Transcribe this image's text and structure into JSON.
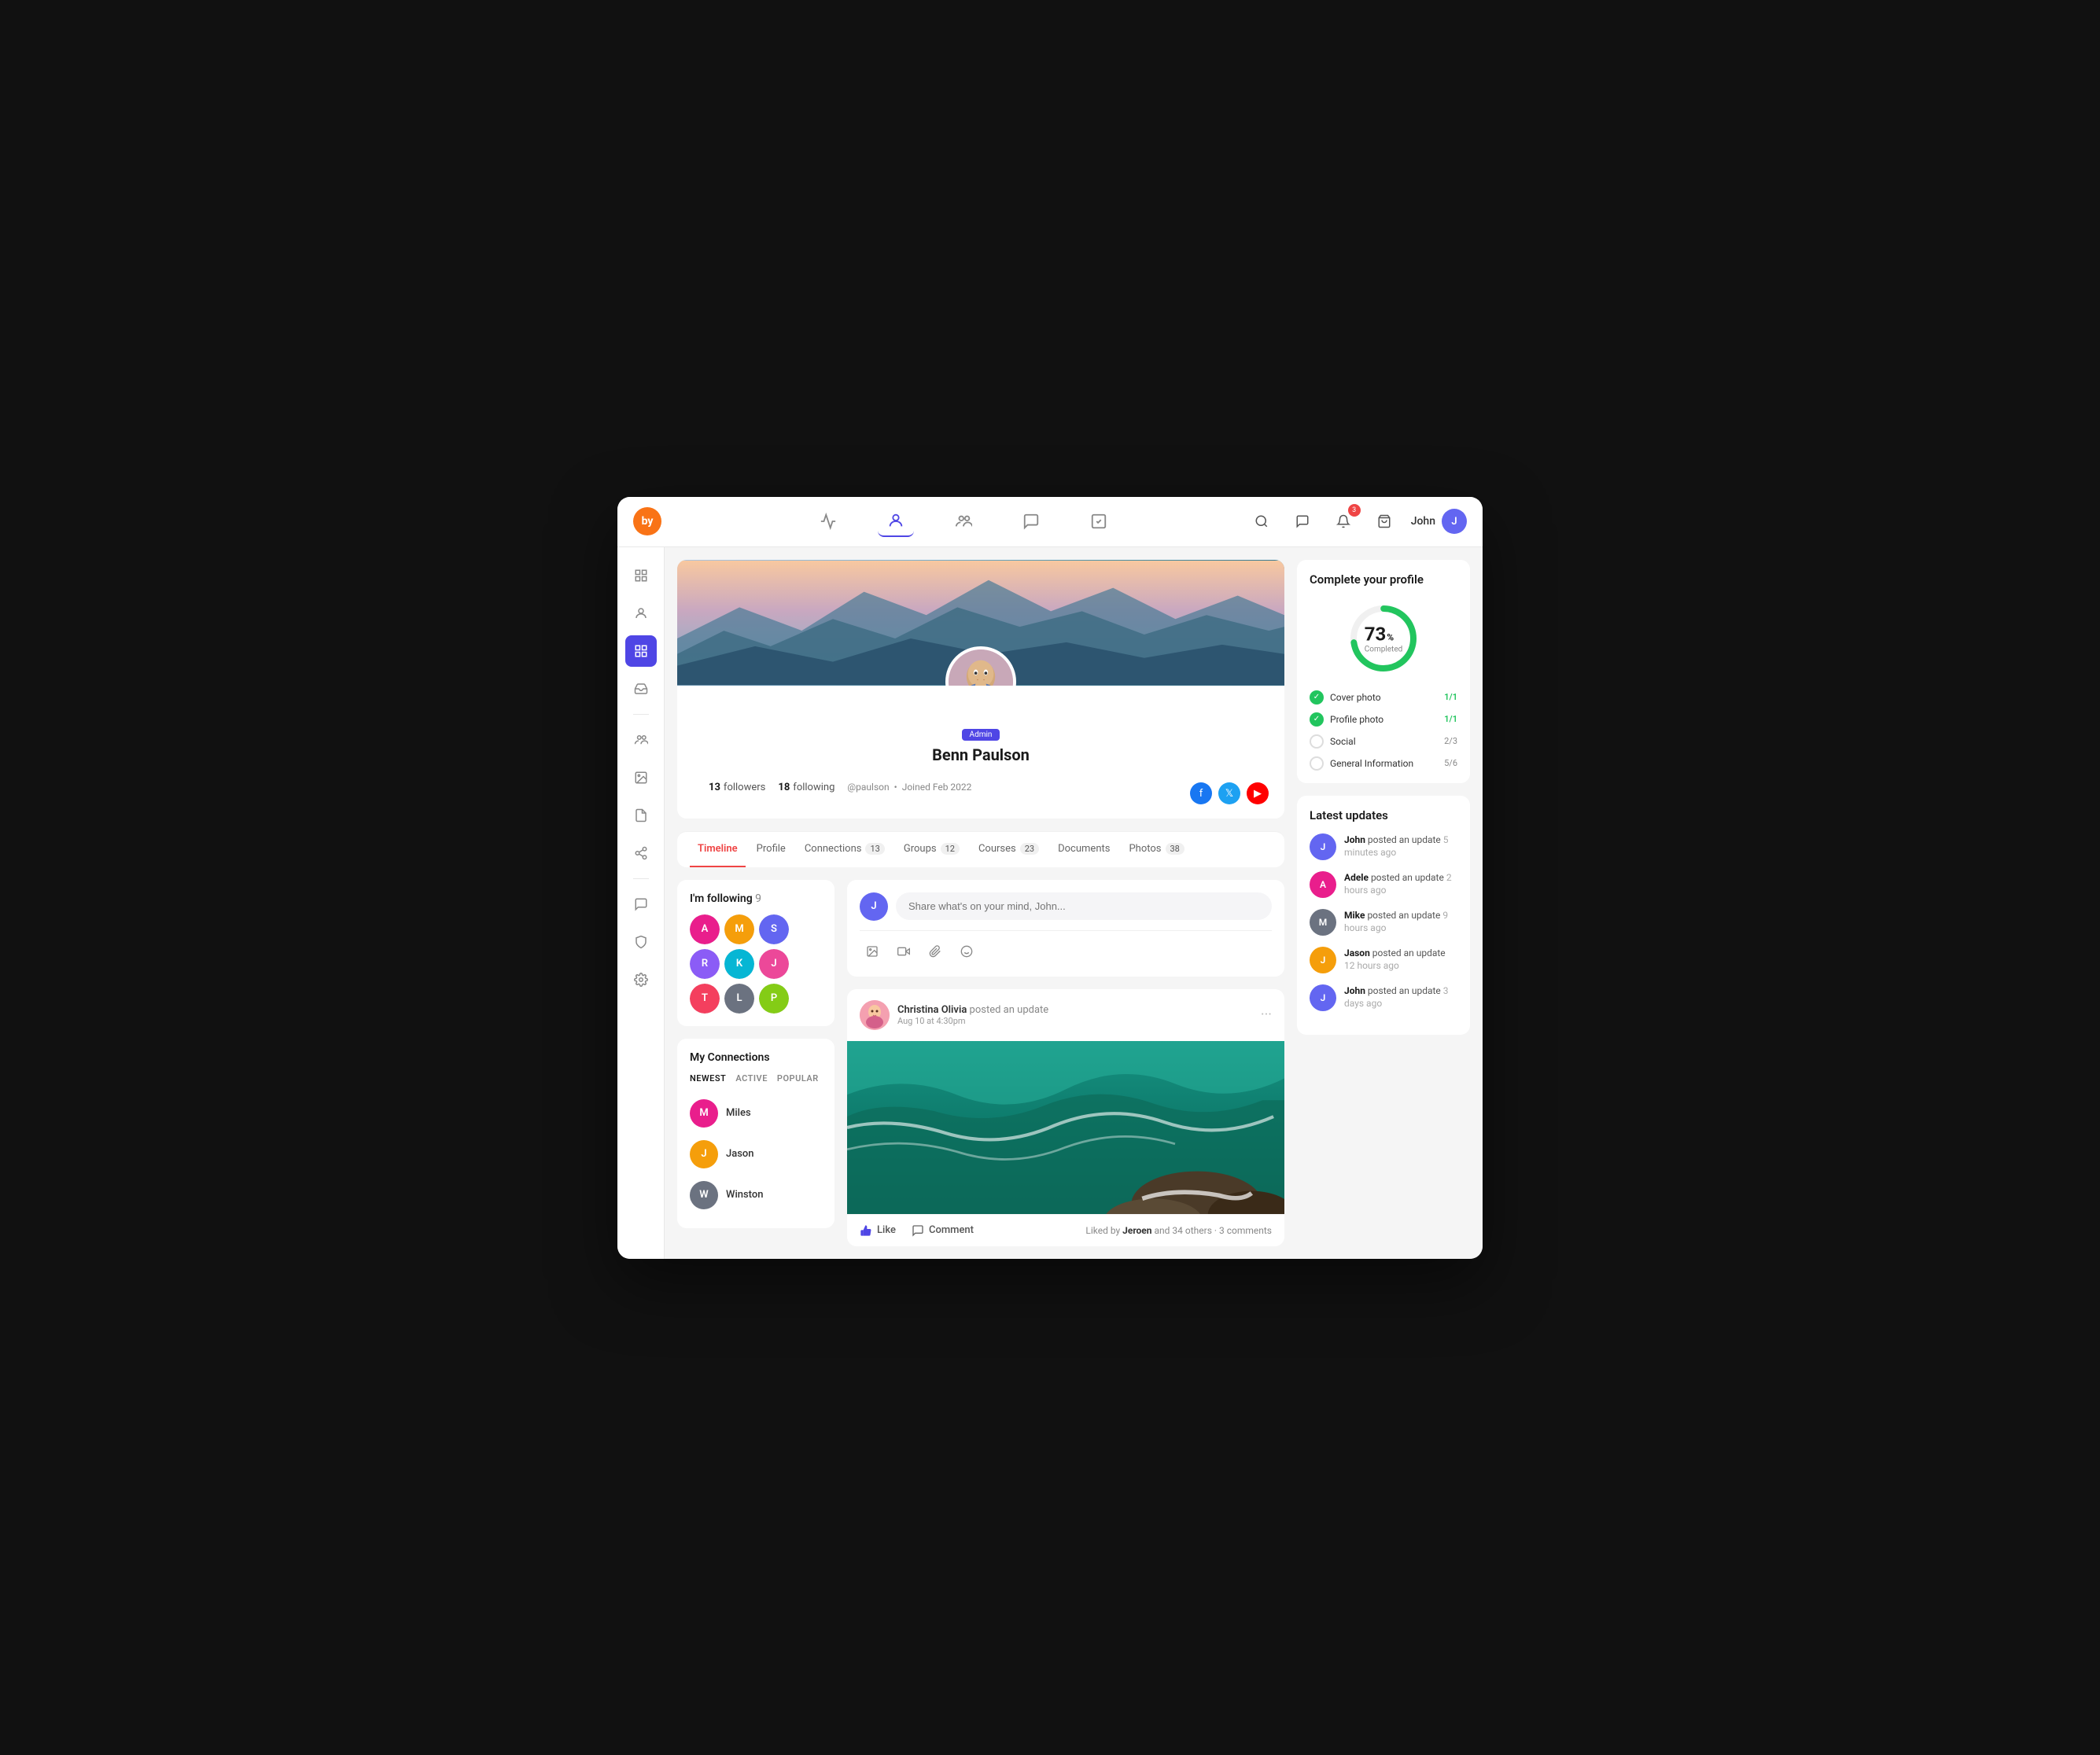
{
  "app": {
    "logo": "by",
    "logo_bg": "#f97316"
  },
  "nav": {
    "items": [
      {
        "name": "activity-icon",
        "label": "Activity",
        "active": false
      },
      {
        "name": "profile-icon",
        "label": "Profile",
        "active": true
      },
      {
        "name": "people-icon",
        "label": "People",
        "active": false
      },
      {
        "name": "messages-icon",
        "label": "Messages",
        "active": false
      },
      {
        "name": "tasks-icon",
        "label": "Tasks",
        "active": false
      }
    ],
    "search_placeholder": "Search",
    "notifications_badge": "3",
    "user_name": "John"
  },
  "sidebar": {
    "items": [
      {
        "name": "menu-toggle",
        "icon": "≡",
        "active": false
      },
      {
        "name": "user-icon",
        "icon": "👤",
        "active": false
      },
      {
        "name": "grid-icon",
        "icon": "⊞",
        "active": true
      },
      {
        "name": "inbox-icon",
        "icon": "📥",
        "active": false
      },
      {
        "name": "divider1"
      },
      {
        "name": "groups-icon",
        "icon": "👥",
        "active": false
      },
      {
        "name": "photos-icon",
        "icon": "🖼",
        "active": false
      },
      {
        "name": "docs-icon",
        "icon": "📄",
        "active": false
      },
      {
        "name": "connections-icon",
        "icon": "🔗",
        "active": false
      },
      {
        "name": "divider2"
      },
      {
        "name": "chat-icon",
        "icon": "💬",
        "active": false
      },
      {
        "name": "shield-icon",
        "icon": "🛡",
        "active": false
      },
      {
        "name": "settings-icon",
        "icon": "⚙",
        "active": false
      }
    ]
  },
  "profile": {
    "name": "Benn Paulson",
    "handle": "@paulson",
    "join_date": "Joined Feb 2022",
    "role": "Admin",
    "followers_count": "13",
    "followers_label": "followers",
    "following_count": "18",
    "following_label": "following",
    "social": [
      "Facebook",
      "Twitter",
      "YouTube"
    ]
  },
  "tabs": {
    "items": [
      {
        "label": "Timeline",
        "count": null,
        "active": true
      },
      {
        "label": "Profile",
        "count": null,
        "active": false
      },
      {
        "label": "Connections",
        "count": "13",
        "active": false
      },
      {
        "label": "Groups",
        "count": "12",
        "active": false
      },
      {
        "label": "Courses",
        "count": "23",
        "active": false
      },
      {
        "label": "Documents",
        "count": null,
        "active": false
      },
      {
        "label": "Photos",
        "count": "38",
        "active": false
      }
    ]
  },
  "following_widget": {
    "title": "I'm following",
    "count": "9",
    "avatars": [
      {
        "initials": "A",
        "color": "#e91e8c"
      },
      {
        "initials": "M",
        "color": "#f59e0b"
      },
      {
        "initials": "S",
        "color": "#6366f1"
      },
      {
        "initials": "R",
        "color": "#8b5cf6"
      },
      {
        "initials": "K",
        "color": "#06b6d4"
      },
      {
        "initials": "J",
        "color": "#ec4899"
      },
      {
        "initials": "T",
        "color": "#f43f5e"
      },
      {
        "initials": "L",
        "color": "#6b7280"
      },
      {
        "initials": "P",
        "color": "#84cc16"
      }
    ]
  },
  "connections_widget": {
    "title": "My Connections",
    "tabs": [
      "NEWEST",
      "ACTIVE",
      "POPULAR"
    ],
    "active_tab": "NEWEST",
    "items": [
      {
        "name": "Miles",
        "color": "#e91e8c",
        "initials": "M"
      },
      {
        "name": "Jason",
        "color": "#f59e0b",
        "initials": "J"
      },
      {
        "name": "Winston",
        "color": "#6b7280",
        "initials": "W"
      }
    ]
  },
  "compose": {
    "placeholder": "Share what's on your mind, John...",
    "actions": [
      "📷",
      "🎥",
      "📎",
      "😊"
    ]
  },
  "post": {
    "author": "Christina Olivia",
    "action": "posted an update",
    "date": "Aug 10 at 4:30pm",
    "like_label": "Like",
    "comment_label": "Comment",
    "liked_by": "Jeroen",
    "liked_by_others": "and 34 others",
    "comments_count": "3 comments"
  },
  "completion": {
    "title": "Complete your profile",
    "percent": "73",
    "percent_symbol": "%",
    "percent_label": "Completed",
    "items": [
      {
        "label": "Cover photo",
        "score": "1/1",
        "done": true
      },
      {
        "label": "Profile photo",
        "score": "1/1",
        "done": true
      },
      {
        "label": "Social",
        "score": "2/3",
        "done": false
      },
      {
        "label": "General Information",
        "score": "5/6",
        "done": false
      }
    ]
  },
  "updates": {
    "title": "Latest updates",
    "items": [
      {
        "name": "John",
        "action": "posted an update",
        "time": "5 minutes ago",
        "color": "#6366f1"
      },
      {
        "name": "Adele",
        "action": "posted an update",
        "time": "2 hours ago",
        "color": "#e91e8c"
      },
      {
        "name": "Mike",
        "action": "posted an update",
        "time": "9 hours ago",
        "color": "#6b7280"
      },
      {
        "name": "Jason",
        "action": "posted an update",
        "time": "12 hours ago",
        "color": "#f59e0b"
      },
      {
        "name": "John",
        "action": "posted an update",
        "time": "3 days ago",
        "color": "#6366f1"
      }
    ]
  }
}
